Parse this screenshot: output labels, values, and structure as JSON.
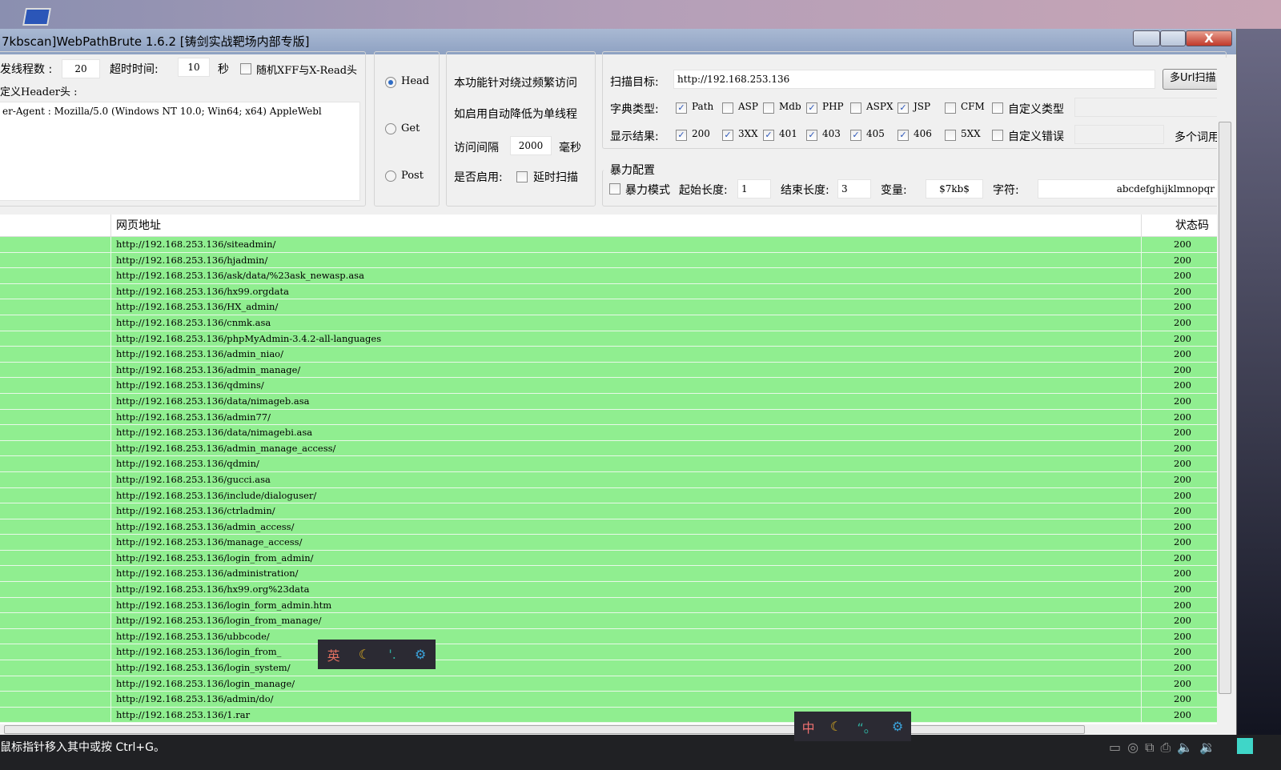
{
  "window": {
    "title": "7kbscan]WebPathBrute 1.6.2 [铸剑实战靶场内部专版]",
    "minimize": "—",
    "maximize": "□",
    "close": "X"
  },
  "config": {
    "threads_label": "发线程数 :",
    "threads": "20",
    "timeout_label": "超时时间:",
    "timeout": "10",
    "timeout_unit": "秒",
    "random_xff_label": "随机XFF与X-Read头",
    "header_label": "定义Header头 :",
    "header_value": "er-Agent : Mozilla/5.0 (Windows NT 10.0; Win64; x64) AppleWebl"
  },
  "method": {
    "options": [
      {
        "label": "Head",
        "selected": true
      },
      {
        "label": "Get",
        "selected": false
      },
      {
        "label": "Post",
        "selected": false
      }
    ]
  },
  "delay": {
    "desc1": "本功能针对绕过频繁访问",
    "desc2": "如启用自动降低为单线程",
    "interval_label": "访问间隔",
    "interval": "2000",
    "interval_unit": "毫秒",
    "enable_label": "是否启用:",
    "delay_scan_label": "延时扫描"
  },
  "scan": {
    "target_label": "扫描目标:",
    "target": "http://192.168.253.136",
    "multi_url_button": "多Url扫描",
    "dict_label": "字典类型:",
    "dict_types": [
      {
        "label": "Path",
        "checked": true
      },
      {
        "label": "ASP",
        "checked": false
      },
      {
        "label": "Mdb",
        "checked": false
      },
      {
        "label": "PHP",
        "checked": true
      },
      {
        "label": "ASPX",
        "checked": false
      },
      {
        "label": "JSP",
        "checked": true
      },
      {
        "label": "CFM",
        "checked": false
      },
      {
        "label": "自定义类型",
        "checked": false
      }
    ],
    "result_label": "显示结果:",
    "result_types": [
      {
        "label": "200",
        "checked": true
      },
      {
        "label": "3XX",
        "checked": true
      },
      {
        "label": "401",
        "checked": true
      },
      {
        "label": "403",
        "checked": true
      },
      {
        "label": "405",
        "checked": true
      },
      {
        "label": "406",
        "checked": true
      },
      {
        "label": "5XX",
        "checked": false
      },
      {
        "label": "自定义错误",
        "checked": false
      }
    ],
    "multi_word_label": "多个词用"
  },
  "brute": {
    "title": "暴力配置",
    "mode_label": "暴力模式",
    "start_len_label": "起始长度:",
    "start_len": "1",
    "end_len_label": "结束长度:",
    "end_len": "3",
    "var_label": "变量:",
    "var": "$7kb$",
    "chars_label": "字符:",
    "chars": "abcdefghijklmnopqr"
  },
  "table": {
    "columns": [
      "网页地址",
      "状态码"
    ],
    "rows": [
      [
        "http://192.168.253.136/siteadmin/",
        "200"
      ],
      [
        "http://192.168.253.136/hjadmin/",
        "200"
      ],
      [
        "http://192.168.253.136/ask/data/%23ask_newasp.asa",
        "200"
      ],
      [
        "http://192.168.253.136/hx99.orgdata",
        "200"
      ],
      [
        "http://192.168.253.136/HX_admin/",
        "200"
      ],
      [
        "http://192.168.253.136/cnmk.asa",
        "200"
      ],
      [
        "http://192.168.253.136/phpMyAdmin-3.4.2-all-languages",
        "200"
      ],
      [
        "http://192.168.253.136/admin_niao/",
        "200"
      ],
      [
        "http://192.168.253.136/admin_manage/",
        "200"
      ],
      [
        "http://192.168.253.136/qdmins/",
        "200"
      ],
      [
        "http://192.168.253.136/data/nimageb.asa",
        "200"
      ],
      [
        "http://192.168.253.136/admin77/",
        "200"
      ],
      [
        "http://192.168.253.136/data/nimagebi.asa",
        "200"
      ],
      [
        "http://192.168.253.136/admin_manage_access/",
        "200"
      ],
      [
        "http://192.168.253.136/qdmin/",
        "200"
      ],
      [
        "http://192.168.253.136/gucci.asa",
        "200"
      ],
      [
        "http://192.168.253.136/include/dialoguser/",
        "200"
      ],
      [
        "http://192.168.253.136/ctrladmin/",
        "200"
      ],
      [
        "http://192.168.253.136/admin_access/",
        "200"
      ],
      [
        "http://192.168.253.136/manage_access/",
        "200"
      ],
      [
        "http://192.168.253.136/login_from_admin/",
        "200"
      ],
      [
        "http://192.168.253.136/administration/",
        "200"
      ],
      [
        "http://192.168.253.136/hx99.org%23data",
        "200"
      ],
      [
        "http://192.168.253.136/login_form_admin.htm",
        "200"
      ],
      [
        "http://192.168.253.136/login_from_manage/",
        "200"
      ],
      [
        "http://192.168.253.136/ubbcode/",
        "200"
      ],
      [
        "http://192.168.253.136/login_from_",
        "200"
      ],
      [
        "http://192.168.253.136/login_system/",
        "200"
      ],
      [
        "http://192.168.253.136/login_manage/",
        "200"
      ],
      [
        "http://192.168.253.136/admin/do/",
        "200"
      ],
      [
        "http://192.168.253.136/1.rar",
        "200"
      ]
    ]
  },
  "status": {
    "text": "鼠标指针移入其中或按 Ctrl+G。"
  },
  "ime1": {
    "mode": "英",
    "moon": "☾",
    "punct": "'.",
    "gear": "⚙"
  },
  "ime2": {
    "mode": "中",
    "moon": "☾",
    "punct": "“。",
    "gear": "⚙"
  },
  "colors": {
    "row_bg": "#90ee90",
    "title_bg": "#8ea1c2"
  }
}
